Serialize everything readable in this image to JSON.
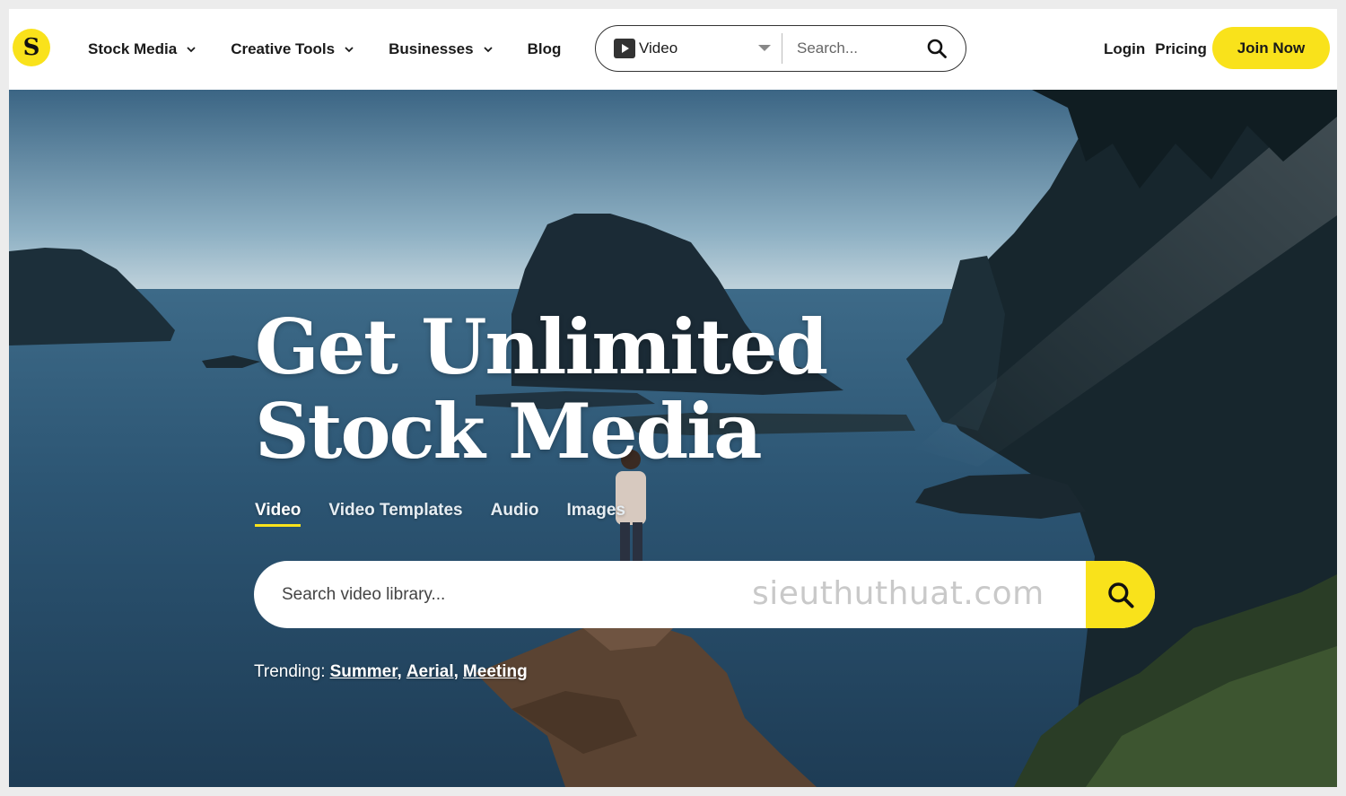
{
  "brand": {
    "logo_letter": "S",
    "accent_color": "#f9e21b"
  },
  "nav": {
    "items": [
      {
        "label": "Stock Media",
        "has_dropdown": true
      },
      {
        "label": "Creative Tools",
        "has_dropdown": true
      },
      {
        "label": "Businesses",
        "has_dropdown": true
      },
      {
        "label": "Blog",
        "has_dropdown": false
      }
    ]
  },
  "top_search": {
    "type_value": "Video",
    "type_icon": "play-icon",
    "placeholder": "Search...",
    "icon": "search-icon"
  },
  "header_links": {
    "login": "Login",
    "pricing": "Pricing",
    "join": "Join Now"
  },
  "hero": {
    "headline_line1": "Get Unlimited",
    "headline_line2": "Stock Media",
    "tabs": [
      {
        "label": "Video",
        "active": true
      },
      {
        "label": "Video Templates",
        "active": false
      },
      {
        "label": "Audio",
        "active": false
      },
      {
        "label": "Images",
        "active": false
      }
    ],
    "search_placeholder": "Search video library...",
    "watermark": "sieuthuthuat.com",
    "trending_label": "Trending:",
    "trending": [
      "Summer,",
      "Aerial,",
      "Meeting"
    ]
  }
}
